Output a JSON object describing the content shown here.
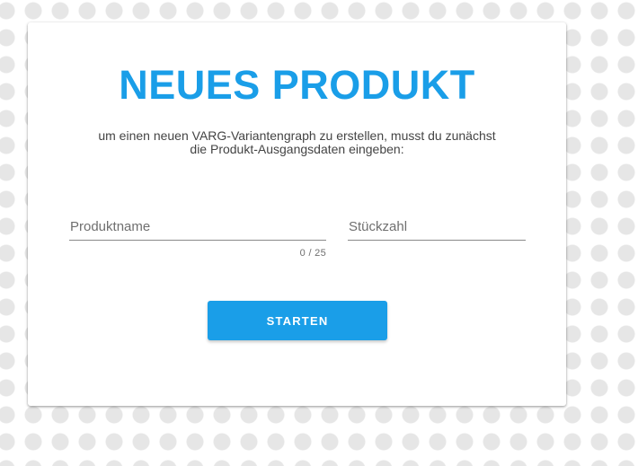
{
  "card": {
    "title": "NEUES PRODUKT",
    "subtitle_line1": "um einen neuen VARG-Variantengraph zu erstellen, musst du zunächst",
    "subtitle_line2": "die Produkt-Ausgangsdaten eingeben:"
  },
  "form": {
    "product_name": {
      "placeholder": "Produktname",
      "value": "",
      "counter": "0 / 25"
    },
    "quantity": {
      "placeholder": "Stückzahl",
      "value": ""
    },
    "start_label": "STARTEN"
  },
  "colors": {
    "accent": "#1a9ee8",
    "background_dots": "#e6e6e6",
    "card": "#ffffff"
  }
}
